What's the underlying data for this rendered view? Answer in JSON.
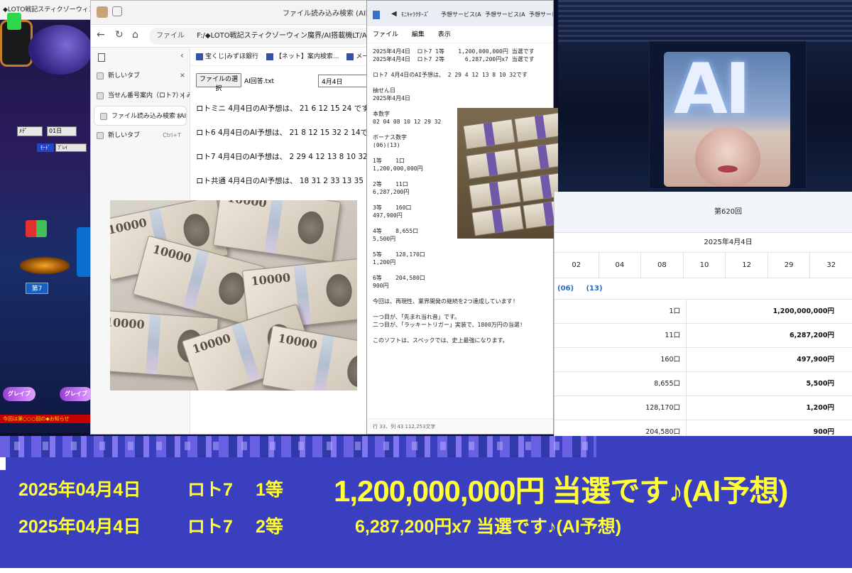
{
  "game": {
    "title": "◆LOTO戦記スティクゾーウィン魔界",
    "select_a": "ﾒﾃﾞ",
    "select_b": "01日",
    "mode_label": "ﾓｰﾄﾞ",
    "mode_value": "ﾌﾟﾚｲ",
    "button7": "第7",
    "logo": "グレイブ",
    "ticker": "今回は第○○○回の◆お知らせ"
  },
  "browser": {
    "window_title": "ファイル読み込み検索 (AI回答",
    "address_prefix": "ファイル",
    "address_path": "F:/◆LOTO戦記スティクゾーウィン魔界/AI搭載機LT/AI/AI搭載プログラム.html",
    "tabs": [
      {
        "label": "新しいタブ",
        "close": "×"
      },
      {
        "label": "当せん番号案内（ロト7）| みずほ銀",
        "close": "×"
      },
      {
        "label": "ファイル読み込み検索 (AI回答.txt)",
        "close": "×"
      },
      {
        "label": "新しいタブ",
        "shortcut": "Ctrl+T"
      }
    ],
    "bookmarks": [
      "宝くじ|みずほ銀行",
      "【ネット】案内検索...",
      "メール - mm 出金会..."
    ],
    "file_button": "ファイルの選択",
    "file_name": "AI回答.txt",
    "date_value": "4月4日",
    "predictions": [
      "ロトミニ 4月4日のAI予想は、 21 6 12 15 24 です",
      "ロト6 4月4日のAI予想は、 21 8 12 15 32 2 14です",
      "ロト7 4月4日のAI予想は、 2 29 4 12 13 8 10 32です",
      "ロト共通 4月4日のAI予想は、 18 31 2 33 13 35 15です"
    ],
    "bill_number": "10000"
  },
  "notepad": {
    "tabs": [
      "ﾓﾆｷｬﾗｸﾀｰｽﾞ",
      "予想サービス(A",
      "予想サービス(A",
      "予想サービス(",
      "ユーザー様("
    ],
    "menu": [
      "ファイル",
      "編集",
      "表示"
    ],
    "lines": [
      "2025年4月4日  ロト7 1等    1,200,000,000円 当選です",
      "2025年4月4日  ロト7 2等      6,287,200円x7 当選です",
      "",
      "ロト7 4月4日のAI予想は、 2 29 4 12 13 8 10 32です",
      "",
      "抽せん日",
      "2025年4月4日",
      "",
      "本数字",
      "02 04 08 10 12 29 32",
      "",
      "ボーナス数字",
      "(06)(13)",
      "",
      "1等    1口",
      "1,200,000,000円",
      "",
      "2等    11口",
      "6,287,200円",
      "",
      "3等    160口",
      "497,900円",
      "",
      "4等    8,655口",
      "5,500円",
      "",
      "5等    128,170口",
      "1,200円",
      "",
      "6等    204,580口",
      "900円",
      "",
      "今回は、再現性、業界開発の継続を2つ達成しています!",
      "",
      "一つ目が、「先まれ当れ音」です。",
      "二つ目が、「ラッキートリガー」実装で、1800万円の当選!",
      "",
      "このソフトは、スペックでは、史上最強になります。"
    ],
    "status": "行 33、列 43    112,253文字"
  },
  "ai_image": {
    "letters": "AI"
  },
  "results": {
    "round": "第620回",
    "date": "2025年4月4日",
    "numbers": [
      "02",
      "04",
      "08",
      "10",
      "12",
      "29",
      "32"
    ],
    "bonus": [
      "(06)",
      "(13)"
    ],
    "prizes": [
      {
        "count": "1口",
        "amount": "1,200,000,000円"
      },
      {
        "count": "11口",
        "amount": "6,287,200円"
      },
      {
        "count": "160口",
        "amount": "497,900円"
      },
      {
        "count": "8,655口",
        "amount": "5,500円"
      },
      {
        "count": "128,170口",
        "amount": "1,200円"
      },
      {
        "count": "204,580口",
        "amount": "900円"
      }
    ]
  },
  "banner": {
    "line1": {
      "date": "2025年04月4日",
      "game": "ロト7",
      "rank": "1等",
      "amount": "1,200,000,000円  当選です♪(AI予想)"
    },
    "line2": {
      "date": "2025年04月4日",
      "game": "ロト7",
      "rank": "2等",
      "amount": "6,287,200円x7  当選です♪(AI予想)"
    },
    "text_color": "#ffff33",
    "bg_color": "#3a3fbf"
  }
}
